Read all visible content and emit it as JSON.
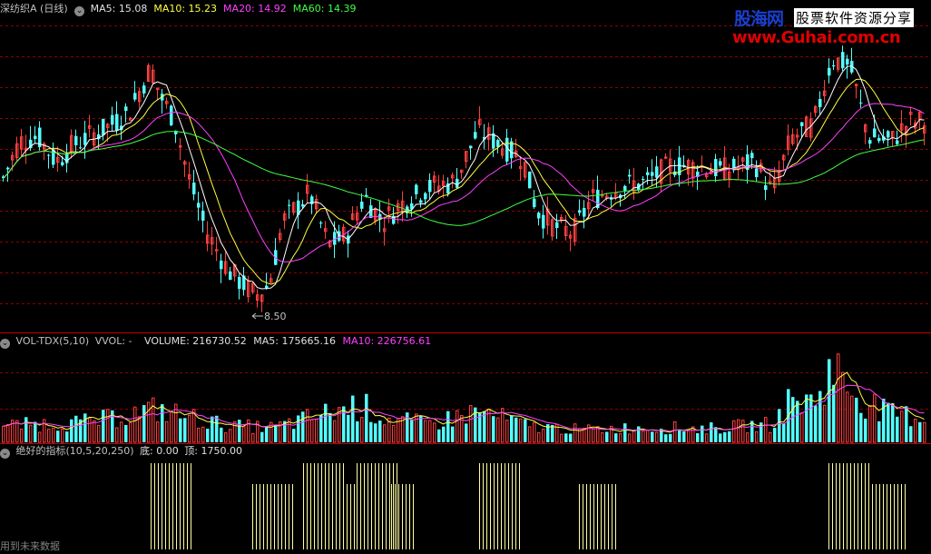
{
  "header": {
    "title": "深纺织A (日线)",
    "ma5_label": "MA5: 15.08",
    "ma10_label": "MA10: 15.23",
    "ma20_label": "MA20: 14.92",
    "ma60_label": "MA60: 14.39"
  },
  "price_panel": {
    "low_marker": "8.50"
  },
  "volume_panel": {
    "name": "VOL-TDX(5,10)",
    "vvol": "VVOL: -",
    "volume": "VOLUME: 216730.52",
    "ma5": "MA5: 175665.16",
    "ma10": "MA10: 226756.61"
  },
  "indicator_panel": {
    "name": "绝好的指标(10,5,20,250)",
    "bottom": "底: 0.00",
    "top": "顶: 1750.00"
  },
  "footer_note": "用到未来数据",
  "watermark": {
    "brand": "股海网",
    "slogan": "股票软件资源分享",
    "url": "www.Guhai.com.cn"
  },
  "colors": {
    "up": "#ff4040",
    "down": "#54ffff",
    "ma5": "#ffffff",
    "ma10": "#ffff40",
    "ma20": "#ff40ff",
    "ma60": "#40ff40",
    "grid": "#8b0000",
    "signal": "#ffffa0",
    "label_white": "#c0c0c0",
    "label_yellow": "#ffff40",
    "label_magenta": "#ff40ff",
    "label_green": "#40ff40"
  },
  "chart_data": {
    "type": "candlestick",
    "price_keypoints": [
      [
        0,
        13.2
      ],
      [
        20,
        14.6
      ],
      [
        40,
        14.8
      ],
      [
        60,
        13.9
      ],
      [
        80,
        14.5
      ],
      [
        110,
        15.0
      ],
      [
        140,
        15.6
      ],
      [
        165,
        17.2
      ],
      [
        175,
        16.2
      ],
      [
        190,
        15.4
      ],
      [
        205,
        13.5
      ],
      [
        225,
        11.5
      ],
      [
        250,
        10.1
      ],
      [
        280,
        9.2
      ],
      [
        295,
        9.6
      ],
      [
        310,
        11.8
      ],
      [
        340,
        12.8
      ],
      [
        360,
        11.0
      ],
      [
        380,
        11.3
      ],
      [
        400,
        12.7
      ],
      [
        420,
        11.8
      ],
      [
        440,
        12.4
      ],
      [
        470,
        13.0
      ],
      [
        500,
        13.2
      ],
      [
        525,
        15.0
      ],
      [
        550,
        14.5
      ],
      [
        575,
        14.0
      ],
      [
        590,
        12.2
      ],
      [
        610,
        11.6
      ],
      [
        630,
        11.4
      ],
      [
        650,
        12.6
      ],
      [
        680,
        13.0
      ],
      [
        710,
        13.2
      ],
      [
        740,
        13.8
      ],
      [
        770,
        13.7
      ],
      [
        800,
        13.6
      ],
      [
        830,
        13.9
      ],
      [
        850,
        12.8
      ],
      [
        870,
        14.7
      ],
      [
        895,
        15.2
      ],
      [
        915,
        17.5
      ],
      [
        935,
        17.3
      ],
      [
        955,
        14.8
      ],
      [
        980,
        14.6
      ],
      [
        1000,
        15.3
      ],
      [
        1026,
        15.3
      ]
    ],
    "volume_keypoints": [
      [
        0,
        2
      ],
      [
        100,
        2.5
      ],
      [
        170,
        4
      ],
      [
        250,
        2
      ],
      [
        300,
        1.8
      ],
      [
        395,
        4.6
      ],
      [
        420,
        3
      ],
      [
        470,
        2.2
      ],
      [
        525,
        3.8
      ],
      [
        580,
        2
      ],
      [
        640,
        1.5
      ],
      [
        700,
        1.8
      ],
      [
        780,
        1.7
      ],
      [
        850,
        2.2
      ],
      [
        870,
        5.2
      ],
      [
        895,
        4.8
      ],
      [
        915,
        9.2
      ],
      [
        940,
        6
      ],
      [
        975,
        3.5
      ],
      [
        1026,
        3
      ]
    ],
    "signal_groups": [
      [
        166,
        212,
        "tall"
      ],
      [
        278,
        322,
        "short"
      ],
      [
        334,
        378,
        "tall"
      ],
      [
        378,
        392,
        "short"
      ],
      [
        393,
        437,
        "tall"
      ],
      [
        431,
        458,
        "short"
      ],
      [
        528,
        572,
        "tall"
      ],
      [
        638,
        681,
        "short"
      ],
      [
        913,
        957,
        "tall"
      ],
      [
        957,
        999,
        "short"
      ]
    ]
  }
}
